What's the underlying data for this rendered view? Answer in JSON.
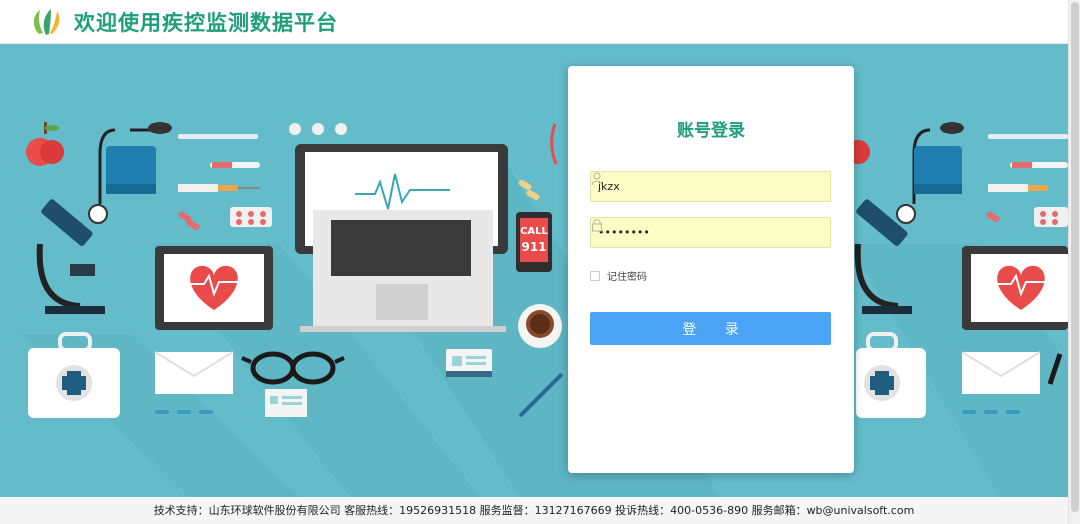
{
  "header": {
    "title": "欢迎使用疾控监测数据平台"
  },
  "hero": {
    "call_text_1": "CALL",
    "call_text_2": "911"
  },
  "login": {
    "title": "账号登录",
    "username_value": "jkzx",
    "password_value": "jkzx2020",
    "remember_label": "记住密码",
    "remember_checked": false,
    "login_label": "登 录"
  },
  "footer": {
    "text": "技术支持：山东环球软件股份有限公司 客服热线：19526931518 服务监督：13127167669 投诉热线：400-0536-890 服务邮箱：wb@univalsoft.com"
  },
  "colors": {
    "brand": "#1e9e7a",
    "hero_bg": "#64bccb",
    "login_button": "#4aa3f4",
    "autofill": "#fafdc4"
  }
}
